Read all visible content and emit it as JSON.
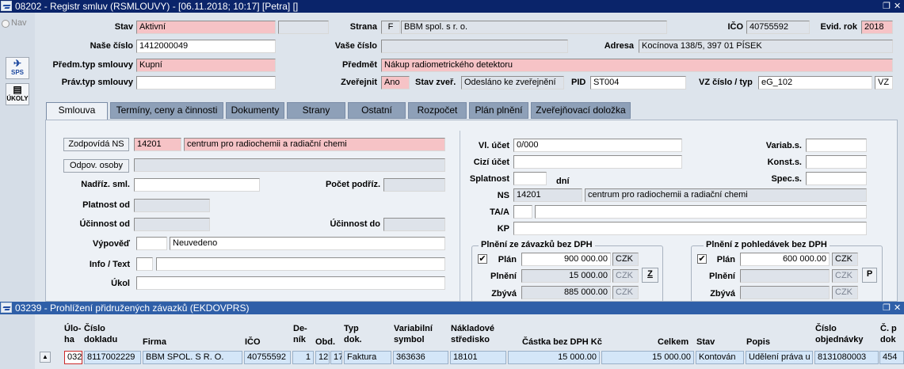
{
  "window_title": "08202 - Registr smluv (RSMLOUVY) - [06.11.2018; 10:17] [Petra] []",
  "nav_label": "Nav",
  "side": {
    "sps": "SPS",
    "ukoly": "ÚKOLY"
  },
  "header": {
    "stav_label": "Stav",
    "stav_value": "Aktivní",
    "strana_label": "Strana",
    "strana_code": "F",
    "strana_value": "BBM spol. s r. o.",
    "ico_label": "IČO",
    "ico_value": "40755592",
    "evid_rok_label": "Evid. rok",
    "evid_rok_value": "2018",
    "nase_cislo_label": "Naše číslo",
    "nase_cislo_value": "1412000049",
    "vase_cislo_label": "Vaše číslo",
    "adresa_label": "Adresa",
    "adresa_value": "Kocínova 138/5, 397 01 PÍSEK",
    "predm_typ_label": "Předm.typ smlouvy",
    "predm_typ_value": "Kupní",
    "predmet_label": "Předmět",
    "predmet_value": "Nákup radiometrického detektoru",
    "prav_typ_label": "Práv.typ smlouvy",
    "zverejnit_label": "Zveřejnit",
    "zverejnit_value": "Ano",
    "stav_zver_label": "Stav zveř.",
    "stav_zver_value": "Odesláno ke zveřejnění",
    "pid_label": "PID",
    "pid_value": "ST004",
    "vz_label": "VZ číslo / typ",
    "vz_value": "eG_102",
    "vz_typ": "VZ"
  },
  "tabs": [
    "Smlouva",
    "Termíny, ceny a činnosti",
    "Dokumenty",
    "Strany",
    "Ostatní",
    "Rozpočet",
    "Plán plnění",
    "Zveřejňovací doložka"
  ],
  "form": {
    "zodpovida_btn": "Zodpovídá NS",
    "zodpovida_code": "14201",
    "zodpovida_name": "centrum pro radiochemii a radiační chemi",
    "odpov_osoby_btn": "Odpov. osoby",
    "nadriz_label": "Nadříz. sml.",
    "pocet_podriz_label": "Počet podříz.",
    "platnost_label": "Platnost od",
    "ucinnost_od_label": "Účinnost od",
    "ucinnost_do_label": "Účinnost do",
    "vypoved_label": "Výpověď",
    "vypoved_value": "Neuvedeno",
    "info_label": "Info / Text",
    "ukol_label": "Úkol",
    "vl_ucet_label": "Vl. účet",
    "vl_ucet_value": "0/000",
    "cizi_ucet_label": "Cizí účet",
    "splatnost_label": "Splatnost",
    "splatnost_unit": "dní",
    "ns_label": "NS",
    "ns_code": "14201",
    "ns_name": "centrum pro radiochemii a radiační chemi",
    "ta_label": "TA/A",
    "kp_label": "KP",
    "variab_label": "Variab.s.",
    "konst_label": "Konst.s.",
    "spec_label": "Spec.s."
  },
  "plneni_zavazky": {
    "title": "Plnění ze závazků bez DPH",
    "plan_label": "Plán",
    "plan_value": "900 000.00",
    "plan_cur": "CZK",
    "plneni_label": "Plnění",
    "plneni_value": "15 000.00",
    "plneni_cur": "CZK",
    "zbyva_label": "Zbývá",
    "zbyva_value": "885 000.00",
    "zbyva_cur": "CZK",
    "z_btn": "Z",
    "checked": "✔"
  },
  "plneni_pohledavky": {
    "title": "Plnění z pohledávek bez DPH",
    "plan_label": "Plán",
    "plan_value": "600 000.00",
    "plan_cur": "CZK",
    "plneni_label": "Plnění",
    "plneni_cur": "CZK",
    "zbyva_label": "Zbývá",
    "zbyva_cur": "CZK",
    "p_btn": "P",
    "checked": "✔"
  },
  "sub_window_title": "03239 - Prohlížení přidružených závazků (EKDOVPRS)",
  "grid": {
    "headers": {
      "uloha": "Úlo-\nha",
      "cislo_dokladu": "Číslo\ndokladu",
      "firma": "Firma",
      "ico": "IČO",
      "denik": "De-\nník",
      "obd": "Obd.",
      "typ": "Typ\ndok.",
      "vs": "Variabilní\nsymbol",
      "ns": "Nákladové\nstředisko",
      "castka": "Částka bez DPH Kč",
      "celkem": "Celkem",
      "stav": "Stav",
      "popis": "Popis",
      "objednavka": "Číslo\nobjednávky",
      "cp": "Č. p\ndok"
    },
    "row": {
      "uloha": "032",
      "cislo_dokladu": "8117002229",
      "firma": "BBM SPOL. S R. O.",
      "ico": "40755592",
      "denik": "1",
      "obd": "12",
      "obd2": "17",
      "typ": "Faktura",
      "vs": "363636",
      "ns": "18101",
      "castka": "15 000.00",
      "celkem": "15 000.00",
      "stav": "Kontován",
      "popis": "Udělení práva u",
      "objednavka": "8131080003",
      "cp": "454"
    }
  }
}
